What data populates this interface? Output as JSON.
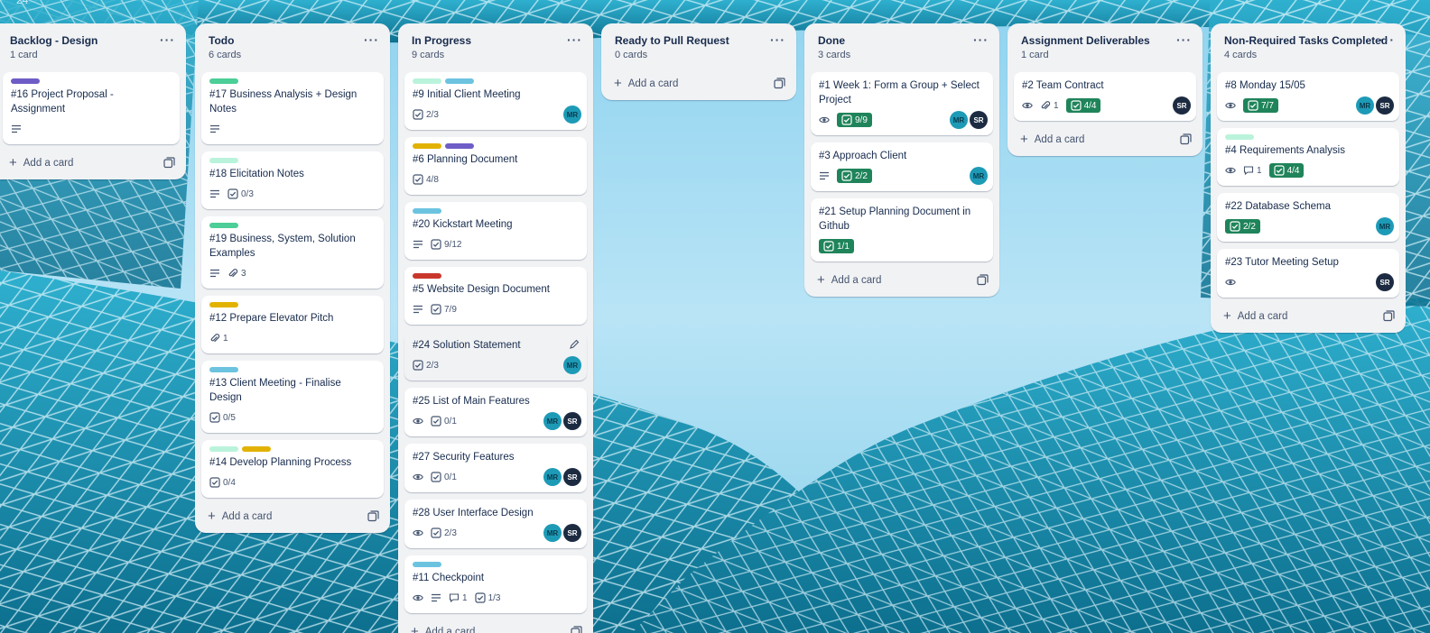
{
  "board": {
    "top_fragment": "24"
  },
  "colors": {
    "purple": "#6e5dc6",
    "green": "#4bce97",
    "mint": "#baf3db",
    "yellow": "#e2b203",
    "teal": "#6cc3e0",
    "red": "#c9372c",
    "done_badge": "#1f845a"
  },
  "add_card_label": "Add a card",
  "lists": [
    {
      "title": "Backlog - Design",
      "count": "1 card",
      "cards": [
        {
          "labels": [
            "purple"
          ],
          "title": "#16 Project Proposal - Assignment",
          "badges": [
            {
              "icon": "description-icon"
            }
          ],
          "members": []
        }
      ]
    },
    {
      "title": "Todo",
      "count": "6 cards",
      "cards": [
        {
          "labels": [
            "green"
          ],
          "title": "#17 Business Analysis + Design Notes",
          "badges": [
            {
              "icon": "description-icon"
            }
          ],
          "members": []
        },
        {
          "labels": [
            "mint"
          ],
          "title": "#18 Elicitation Notes",
          "badges": [
            {
              "icon": "description-icon"
            },
            {
              "icon": "checklist-icon",
              "text": "0/3"
            }
          ],
          "members": []
        },
        {
          "labels": [
            "green"
          ],
          "title": "#19 Business, System, Solution Examples",
          "badges": [
            {
              "icon": "description-icon"
            },
            {
              "icon": "attachment-icon",
              "text": "3"
            }
          ],
          "members": []
        },
        {
          "labels": [
            "yellow"
          ],
          "title": "#12 Prepare Elevator Pitch",
          "badges": [
            {
              "icon": "attachment-icon",
              "text": "1"
            }
          ],
          "members": []
        },
        {
          "labels": [
            "teal"
          ],
          "title": "#13 Client Meeting - Finalise Design",
          "badges": [
            {
              "icon": "checklist-icon",
              "text": "0/5"
            }
          ],
          "members": []
        },
        {
          "labels": [
            "mint",
            "yellow"
          ],
          "title": "#14 Develop Planning Process",
          "badges": [
            {
              "icon": "checklist-icon",
              "text": "0/4"
            }
          ],
          "members": []
        }
      ]
    },
    {
      "title": "In Progress",
      "count": "9 cards",
      "cards": [
        {
          "labels": [
            "mint",
            "teal"
          ],
          "title": "#9 Initial Client Meeting",
          "badges": [
            {
              "icon": "checklist-icon",
              "text": "2/3"
            }
          ],
          "members": [
            "MR"
          ]
        },
        {
          "labels": [
            "yellow",
            "purple"
          ],
          "title": "#6 Planning Document",
          "badges": [
            {
              "icon": "checklist-icon",
              "text": "4/8"
            }
          ],
          "members": []
        },
        {
          "labels": [
            "teal"
          ],
          "title": "#20 Kickstart Meeting",
          "badges": [
            {
              "icon": "description-icon"
            },
            {
              "icon": "checklist-icon",
              "text": "9/12"
            }
          ],
          "members": []
        },
        {
          "labels": [
            "red"
          ],
          "title": "#5 Website Design Document",
          "badges": [
            {
              "icon": "description-icon"
            },
            {
              "icon": "checklist-icon",
              "text": "7/9"
            }
          ],
          "members": []
        },
        {
          "labels": [],
          "title": "#24 Solution Statement",
          "hover": true,
          "badges": [
            {
              "icon": "checklist-icon",
              "text": "2/3"
            }
          ],
          "members": [
            "MR"
          ]
        },
        {
          "labels": [],
          "title": "#25 List of Main Features",
          "badges": [
            {
              "icon": "watch-icon"
            },
            {
              "icon": "checklist-icon",
              "text": "0/1"
            }
          ],
          "members": [
            "MR",
            "SR"
          ]
        },
        {
          "labels": [],
          "title": "#27 Security Features",
          "badges": [
            {
              "icon": "watch-icon"
            },
            {
              "icon": "checklist-icon",
              "text": "0/1"
            }
          ],
          "members": [
            "MR",
            "SR"
          ]
        },
        {
          "labels": [],
          "title": "#28 User Interface Design",
          "badges": [
            {
              "icon": "watch-icon"
            },
            {
              "icon": "checklist-icon",
              "text": "2/3"
            }
          ],
          "members": [
            "MR",
            "SR"
          ]
        },
        {
          "labels": [
            "teal"
          ],
          "title": "#11 Checkpoint",
          "badges": [
            {
              "icon": "watch-icon"
            },
            {
              "icon": "description-icon"
            },
            {
              "icon": "comment-icon",
              "text": "1"
            },
            {
              "icon": "checklist-icon",
              "text": "1/3"
            }
          ],
          "members": []
        }
      ]
    },
    {
      "title": "Ready to Pull Request",
      "count": "0 cards",
      "cards": []
    },
    {
      "title": "Done",
      "count": "3 cards",
      "cards": [
        {
          "labels": [],
          "title": "#1 Week 1: Form a Group + Select Project",
          "badges": [
            {
              "icon": "watch-icon"
            },
            {
              "icon": "checklist-icon",
              "text": "9/9",
              "done": true
            }
          ],
          "members": [
            "MR",
            "SR"
          ]
        },
        {
          "labels": [],
          "title": "#3 Approach Client",
          "badges": [
            {
              "icon": "description-icon"
            },
            {
              "icon": "checklist-icon",
              "text": "2/2",
              "done": true
            }
          ],
          "members": [
            "MR"
          ]
        },
        {
          "labels": [],
          "title": "#21 Setup Planning Document in Github",
          "badges": [
            {
              "icon": "checklist-icon",
              "text": "1/1",
              "done": true
            }
          ],
          "members": []
        }
      ]
    },
    {
      "title": "Assignment Deliverables",
      "count": "1 card",
      "cards": [
        {
          "labels": [],
          "title": "#2 Team Contract",
          "badges": [
            {
              "icon": "watch-icon"
            },
            {
              "icon": "attachment-icon",
              "text": "1"
            },
            {
              "icon": "checklist-icon",
              "text": "4/4",
              "done": true
            }
          ],
          "members": [
            "SR"
          ]
        }
      ]
    },
    {
      "title": "Non-Required Tasks Completed",
      "count": "4 cards",
      "cards": [
        {
          "labels": [],
          "title": "#8 Monday 15/05",
          "badges": [
            {
              "icon": "watch-icon"
            },
            {
              "icon": "checklist-icon",
              "text": "7/7",
              "done": true
            }
          ],
          "members": [
            "MR",
            "SR"
          ]
        },
        {
          "labels": [
            "mint"
          ],
          "title": "#4 Requirements Analysis",
          "badges": [
            {
              "icon": "watch-icon"
            },
            {
              "icon": "comment-icon",
              "text": "1"
            },
            {
              "icon": "checklist-icon",
              "text": "4/4",
              "done": true
            }
          ],
          "members": []
        },
        {
          "labels": [],
          "title": "#22 Database Schema",
          "badges": [
            {
              "icon": "checklist-icon",
              "text": "2/2",
              "done": true
            }
          ],
          "members": [
            "MR"
          ]
        },
        {
          "labels": [],
          "title": "#23 Tutor Meeting Setup",
          "badges": [
            {
              "icon": "watch-icon"
            }
          ],
          "members": [
            "SR"
          ]
        }
      ]
    }
  ]
}
